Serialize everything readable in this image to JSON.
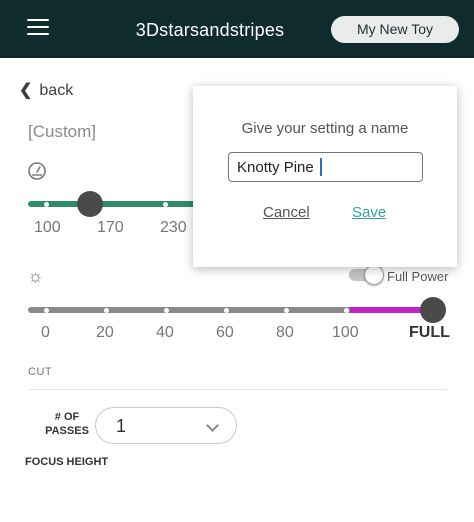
{
  "header": {
    "title": "3Dstarsandstripes",
    "device_label": "My New Toy",
    "background": "#0f2b2e"
  },
  "page": {
    "back_label": "back",
    "setting_name": "[Custom]"
  },
  "speed": {
    "icon": "speedometer-icon",
    "labels": [
      "100",
      "170",
      "230"
    ],
    "track_color": "#2e8b6a"
  },
  "power": {
    "icon": "sun-icon",
    "toggle_label": "Full Power",
    "labels": [
      "0",
      "20",
      "40",
      "60",
      "80",
      "100"
    ],
    "full_label": "FULL",
    "full_color": "#c021c8"
  },
  "cut": {
    "label": "CUT",
    "passes_label": "# OF PASSES",
    "passes_value": "1",
    "focus_label": "FOCUS HEIGHT"
  },
  "dialog": {
    "title": "Give your setting a name",
    "input_value": "Knotty Pine",
    "cancel_label": "Cancel",
    "save_label": "Save",
    "save_color": "#3aa0a8"
  }
}
